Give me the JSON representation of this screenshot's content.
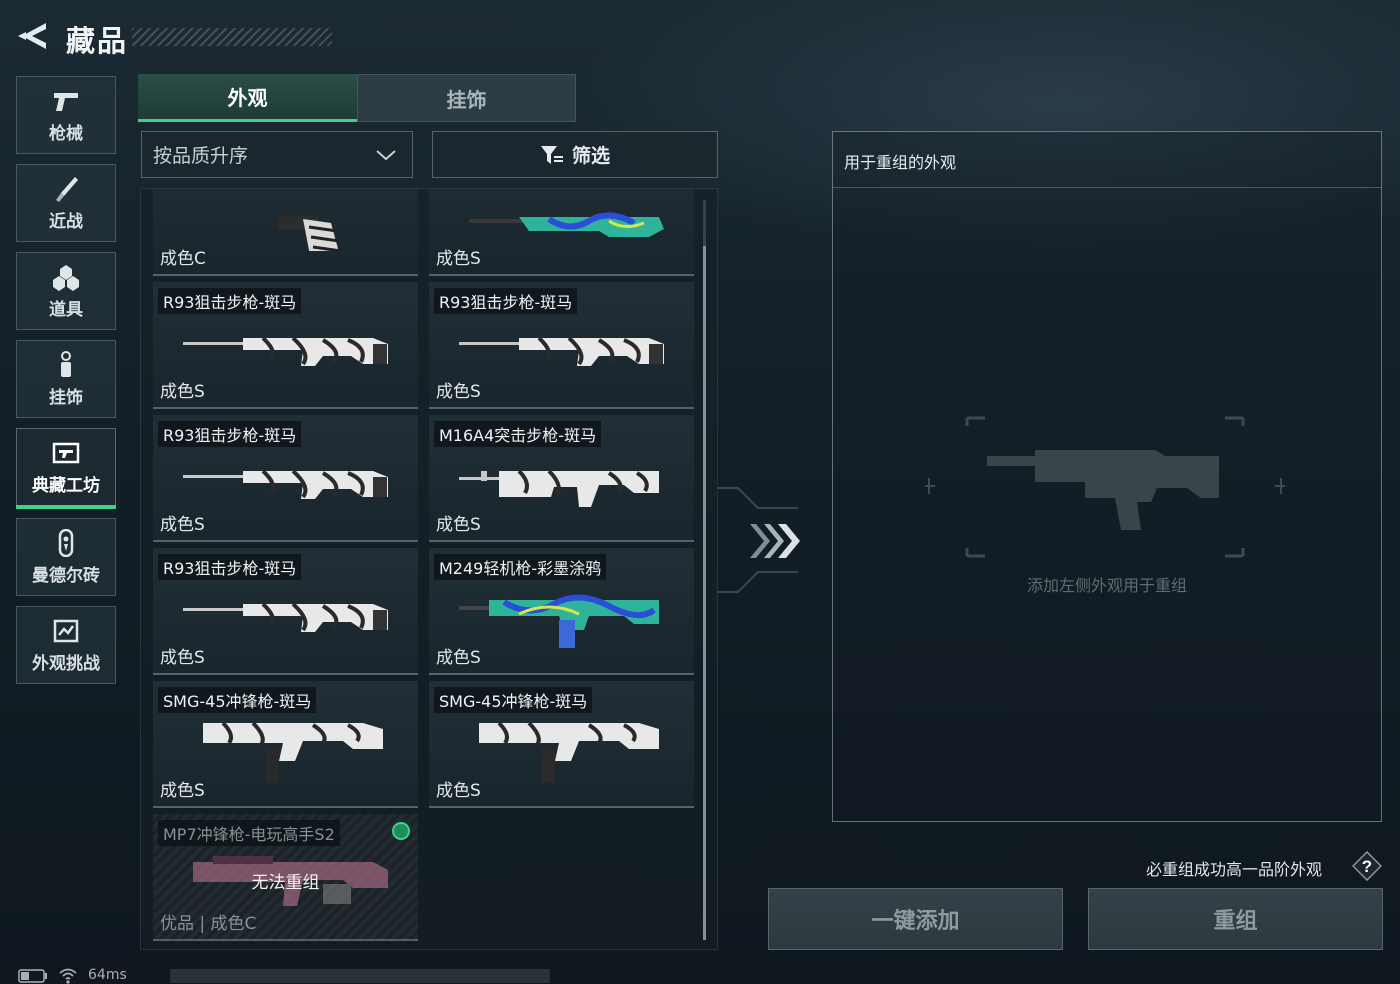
{
  "header": {
    "title": "藏品"
  },
  "nav": {
    "items": [
      {
        "label": "枪械",
        "icon": "pistol-icon"
      },
      {
        "label": "近战",
        "icon": "knife-icon"
      },
      {
        "label": "道具",
        "icon": "grenade-icon"
      },
      {
        "label": "挂饰",
        "icon": "charm-icon"
      },
      {
        "label": "典藏工坊",
        "icon": "workshop-icon",
        "active": true
      },
      {
        "label": "曼德尔砖",
        "icon": "mandel-brick-icon"
      },
      {
        "label": "外观挑战",
        "icon": "challenge-icon"
      }
    ]
  },
  "tabs": [
    {
      "label": "外观",
      "active": true
    },
    {
      "label": "挂饰",
      "active": false
    }
  ],
  "sort": {
    "selected": "按品质升序"
  },
  "filter": {
    "label": "筛选"
  },
  "grid": {
    "items": [
      {
        "name": "",
        "grade": "成色C",
        "gun": "pistol-grip"
      },
      {
        "name": "",
        "grade": "成色S",
        "gun": "rifle-graffiti"
      },
      {
        "name": "R93狙击步枪-斑马",
        "grade": "成色S",
        "gun": "sniper-zebra"
      },
      {
        "name": "R93狙击步枪-斑马",
        "grade": "成色S",
        "gun": "sniper-zebra"
      },
      {
        "name": "R93狙击步枪-斑马",
        "grade": "成色S",
        "gun": "sniper-zebra"
      },
      {
        "name": "M16A4突击步枪-斑马",
        "grade": "成色S",
        "gun": "rifle-zebra"
      },
      {
        "name": "R93狙击步枪-斑马",
        "grade": "成色S",
        "gun": "sniper-zebra"
      },
      {
        "name": "M249轻机枪-彩墨涂鸦",
        "grade": "成色S",
        "gun": "lmg-graffiti"
      },
      {
        "name": "SMG-45冲锋枪-斑马",
        "grade": "成色S",
        "gun": "smg-zebra"
      },
      {
        "name": "SMG-45冲锋枪-斑马",
        "grade": "成色S",
        "gun": "smg-zebra"
      },
      {
        "name": "MP7冲锋枪-电玩高手S2",
        "grade": "优品 | 成色C",
        "gun": "smg-pink",
        "disabled": true,
        "lock_text": "无法重组"
      }
    ]
  },
  "right_panel": {
    "title": "用于重组的外观",
    "placeholder": "添加左侧外观用于重组"
  },
  "note": "必重组成功高一品阶外观",
  "buttons": {
    "add_all": "一键添加",
    "remix": "重组"
  },
  "status": {
    "ping": "64ms"
  },
  "colors": {
    "accent": "#3fd08a",
    "background": "#15222b"
  }
}
